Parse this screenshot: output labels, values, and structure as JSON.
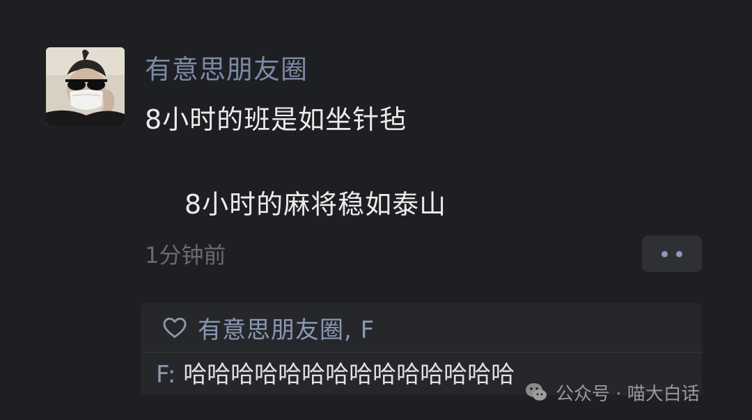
{
  "post": {
    "username": "有意思朋友圈",
    "line1": "8小时的班是如坐针毡",
    "line2": "8小时的麻将稳如泰山",
    "timestamp": "1分钟前"
  },
  "interactions": {
    "likes": "有意思朋友圈, F",
    "comment": {
      "author": "F: ",
      "text": "哈哈哈哈哈哈哈哈哈哈哈哈哈哈"
    }
  },
  "watermark": {
    "text": "公众号 · 喵大白话"
  },
  "colors": {
    "background": "#1e1f22",
    "name_link": "#7d8aa6",
    "body_text": "#ececec",
    "muted": "#6b6b6e"
  },
  "icons": [
    "heart-outline-icon",
    "more-dots-icon",
    "wechat-official-icon"
  ]
}
